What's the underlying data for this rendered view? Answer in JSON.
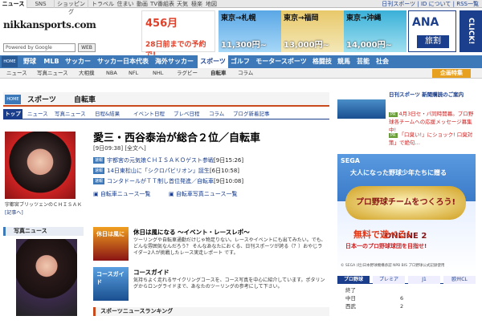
{
  "top_tabs": [
    "ニュース",
    "SNS",
    "ショッピング",
    "トラベル",
    "住まい",
    "動画",
    "TV番組表",
    "天気",
    "極楽",
    "地図"
  ],
  "top_links": "日刊スポーツ | ID について | RSS一覧",
  "logo": "nikkansports.com",
  "search": {
    "label": "Powered by Google",
    "button": "WEB"
  },
  "banner": {
    "promo_big": "456月",
    "promo_sub": "28日前までの予約で!",
    "routes": [
      {
        "dest": "東京→札幌",
        "price": "11,300円~"
      },
      {
        "dest": "東京→福岡",
        "price": "13,000円~"
      },
      {
        "dest": "東京→沖縄",
        "price": "14,000円~"
      }
    ],
    "airline": "ANA",
    "airline_sub": "旅割",
    "click": "CLICK!"
  },
  "nav": {
    "home": "HOME",
    "items": [
      "野球",
      "MLB",
      "サッカー",
      "サッカー日本代表",
      "海外サッカー",
      "スポーツ",
      "ゴルフ",
      "モータースポーツ",
      "格闘技",
      "競馬",
      "芸能",
      "社会"
    ],
    "active": "スポーツ"
  },
  "subnav": {
    "items": [
      "ニュース",
      "写真ニュース",
      "大相撲",
      "NBA",
      "NFL",
      "NHL",
      "ラグビー",
      "自転車",
      "コラム"
    ],
    "feature": "企画特集"
  },
  "breadcrumb": {
    "home": "HOME",
    "section": "スポーツ",
    "page": "自転車"
  },
  "section_tabs": [
    "トップ",
    "ニュース",
    "写真ニュース",
    "日程&結果",
    "イベント日程",
    "ブレベ日程",
    "コラム",
    "ブログ新着記事"
  ],
  "article": {
    "headline": "愛三・西谷泰治が総合２位／自転車",
    "date": "[9日09:38] [全文へ]",
    "related": [
      {
        "tag": "速報",
        "text": "宇都宮の元気娘ＣＨＩＳＡＫＯゲスト参戦",
        "date": "[9日15:26]"
      },
      {
        "tag": "速報",
        "text": "14日東松山に「シクロパビリオン」誕生",
        "date": "[6日10:58]"
      },
      {
        "tag": "速報",
        "text": "コンタドールがＴＴ制し首位発進／自転車",
        "date": "[9日10:08]"
      }
    ],
    "link_news": "自転車ニュース一覧",
    "link_photo": "自転車写真ニュース一覧",
    "caption": "宇都宮ブリッツェンのＣＨＩＳＡＫ",
    "caption_link": "[記事へ]"
  },
  "photo_news": {
    "title": "写真ニュース",
    "link": "[記事へ]"
  },
  "events": [
    {
      "title": "休日は風になる ～イベント・レースレポ～",
      "body": "ツーリングや自転車通勤だけじゃ物足りない。レースやイベントにも出てみたい。でも、どんな雰囲気なんだろう？ そんなあなたにおくる、日刊スポーツが誇る（？）おやじライダー2人が挑戦したレース実走レポート です。",
      "img": "休日は風に"
    },
    {
      "title": "コースガイド",
      "body": "気持ちよく走れるサイクリングコースを、コース写真を中心に紹介しています。ポタリングからロングライドまで、あなたのツーリングの参考にして下さい。",
      "img": "コースガイド"
    }
  ],
  "ranking_title": "スポーツニュースランキング",
  "right": {
    "pr1_label": "日刊スポーツ 新聞購読のご案内",
    "pr_lines": [
      {
        "tag": "PR",
        "text": "4月3日セ・パ同時開幕。プロ野球各チームへの応援メッセージ募集中!"
      },
      {
        "tag": "PR",
        "text": "「口臭い!」にショック! 口臭対策」で絶句…"
      }
    ],
    "sega": {
      "logo": "SEGA",
      "head": "大人になった野球少年たちに贈る",
      "game": "プロ野球チームをつくろう! ONLINE 2",
      "free": "無料で遊べる!",
      "slogan": "日本一のプロ野球球団を目指せ!",
      "copy": "© SEGA (社)日本野球機構承認 NPB BIS プロ野球公式記録使用"
    },
    "score_tabs": [
      "プロ野球",
      "プレミア",
      "J1",
      "欧州CL"
    ],
    "scores": [
      {
        "label": "終了",
        "score": ""
      },
      {
        "label": "中日",
        "score": "6"
      },
      {
        "label": "西武",
        "score": "2"
      }
    ]
  }
}
